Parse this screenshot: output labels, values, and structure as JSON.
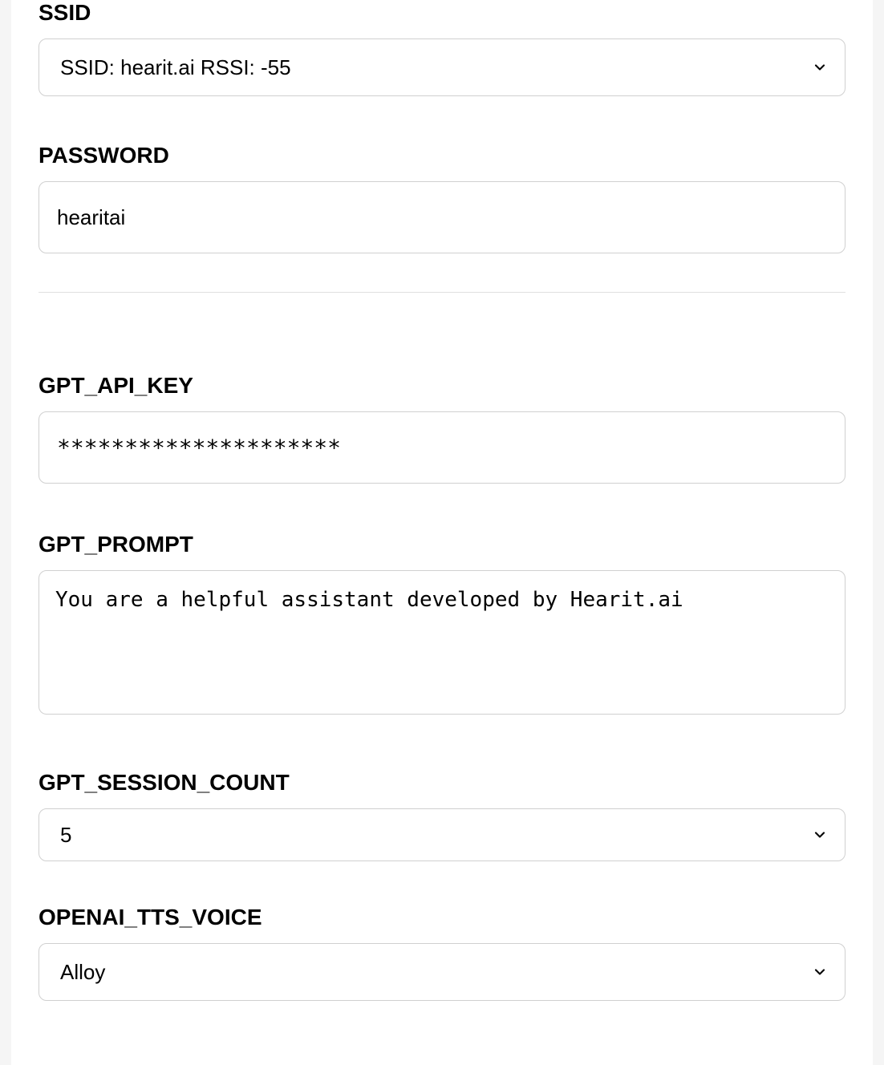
{
  "fields": {
    "ssid": {
      "label": "SSID",
      "value": "SSID: hearit.ai RSSI: -55"
    },
    "password": {
      "label": "PASSWORD",
      "value": "hearitai"
    },
    "gpt_api_key": {
      "label": "GPT_API_KEY",
      "value": "*********************"
    },
    "gpt_prompt": {
      "label": "GPT_PROMPT",
      "value": "You are a helpful assistant developed by Hearit.ai"
    },
    "gpt_session_count": {
      "label": "GPT_SESSION_COUNT",
      "value": "5"
    },
    "openai_tts_voice": {
      "label": "OPENAI_TTS_VOICE",
      "value": "Alloy"
    }
  }
}
